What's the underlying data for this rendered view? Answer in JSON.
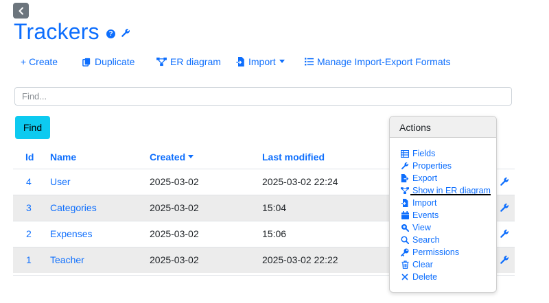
{
  "page": {
    "title": "Trackers"
  },
  "toolbar": {
    "create": "+ Create",
    "duplicate": "Duplicate",
    "er_diagram": "ER diagram",
    "import": "Import",
    "manage_formats": "Manage Import-Export Formats"
  },
  "search": {
    "placeholder": "Find...",
    "value": "",
    "button_label": "Find"
  },
  "table": {
    "headers": {
      "id": "Id",
      "name": "Name",
      "created": "Created",
      "modified": "Last modified"
    },
    "sort_column": "Created",
    "rows": [
      {
        "id": "4",
        "name": "User",
        "created": "2025-03-02",
        "modified": "2025-03-02 22:24"
      },
      {
        "id": "3",
        "name": "Categories",
        "created": "2025-03-02",
        "modified": "15:04"
      },
      {
        "id": "2",
        "name": "Expenses",
        "created": "2025-03-02",
        "modified": "15:06"
      },
      {
        "id": "1",
        "name": "Teacher",
        "created": "2025-03-02",
        "modified": "2025-03-02 22:22"
      }
    ]
  },
  "actions": {
    "header": "Actions",
    "items": [
      {
        "label": "Fields",
        "icon": "table-icon"
      },
      {
        "label": "Properties",
        "icon": "wrench-icon"
      },
      {
        "label": "Export",
        "icon": "export-icon"
      },
      {
        "label": "Show in ER diagram",
        "icon": "diagram-icon"
      },
      {
        "label": "Import",
        "icon": "import-icon"
      },
      {
        "label": "Events",
        "icon": "calendar-icon"
      },
      {
        "label": "View",
        "icon": "zoom-icon"
      },
      {
        "label": "Search",
        "icon": "search-icon"
      },
      {
        "label": "Permissions",
        "icon": "key-icon"
      },
      {
        "label": "Clear",
        "icon": "trash-icon"
      },
      {
        "label": "Delete",
        "icon": "x-icon"
      }
    ]
  },
  "colors": {
    "primary": "#0d6efd",
    "info": "#0dcaf0",
    "secondary": "#6c757d"
  }
}
